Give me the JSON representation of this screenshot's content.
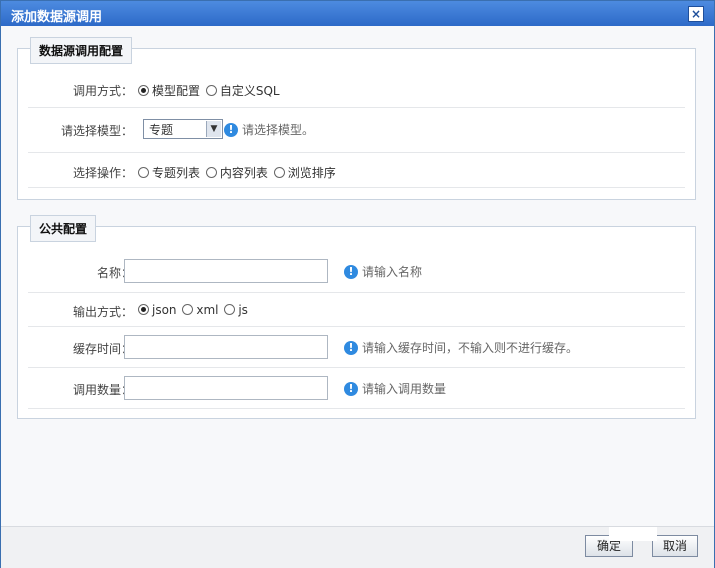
{
  "dialog": {
    "title": "添加数据源调用",
    "close_label": "×"
  },
  "section_model": {
    "legend": "数据源调用配置",
    "call_mode": {
      "label": "调用方式：",
      "options": [
        "模型配置",
        "自定义SQL"
      ],
      "selected": "模型配置"
    },
    "model": {
      "label": "请选择模型：",
      "selected": "专题",
      "hint": "请选择模型。"
    },
    "operation": {
      "label": "选择操作：",
      "options": [
        "专题列表",
        "内容列表",
        "浏览排序"
      ]
    }
  },
  "section_common": {
    "legend": "公共配置",
    "name": {
      "label": "名称：",
      "value": "",
      "hint": "请输入名称"
    },
    "output": {
      "label": "输出方式：",
      "options": [
        "json",
        "xml",
        "js"
      ],
      "selected": "json"
    },
    "cache": {
      "label": "缓存时间：",
      "value": "",
      "hint": "请输入缓存时间，不输入则不进行缓存。"
    },
    "count": {
      "label": "调用数量：",
      "value": "",
      "hint": "请输入调用数量"
    }
  },
  "footer": {
    "ok_label": "确定",
    "cancel_label": "取消"
  },
  "colors": {
    "titlebar": "#2d6ac8",
    "hint_icon": "#2f8ae0"
  }
}
